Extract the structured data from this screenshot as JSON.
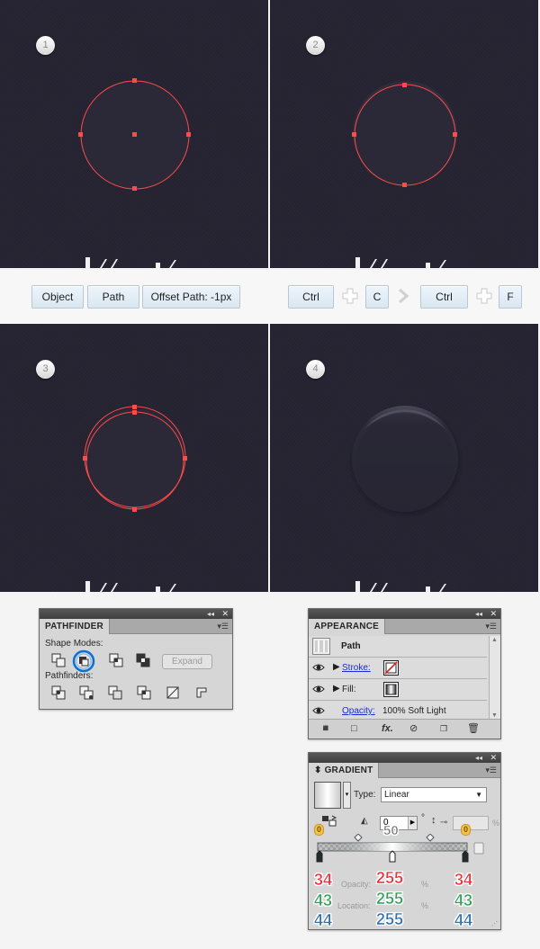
{
  "steps": [
    {
      "number": "1"
    },
    {
      "number": "2"
    },
    {
      "number": "3"
    },
    {
      "number": "4"
    }
  ],
  "colors": {
    "artboard": "#262432",
    "selection": "#ff4a4a",
    "circle_fill": "#2b2938",
    "highlight_ring": "#0a72d6"
  },
  "key_strip": {
    "left_keys": [
      "Object",
      "Path",
      "Offset Path: -1px"
    ],
    "right_keys": [
      "Ctrl",
      "C",
      "Ctrl",
      "F"
    ]
  },
  "pathfinder": {
    "title": "PATHFINDER",
    "shape_modes_label": "Shape Modes:",
    "pathfinders_label": "Pathfinders:",
    "expand_label": "Expand",
    "shape_mode_icons": [
      "unite-icon",
      "minus-front-icon",
      "intersect-icon",
      "exclude-icon"
    ],
    "pathfinder_icons": [
      "divide-icon",
      "trim-icon",
      "merge-icon",
      "crop-icon",
      "outline-icon",
      "minus-back-icon"
    ],
    "highlighted": "minus-front-icon"
  },
  "appearance": {
    "title": "APPEARANCE",
    "object_label": "Path",
    "stroke_label": "Stroke:",
    "fill_label": "Fill:",
    "opacity_label": "Opacity:",
    "opacity_value": "100% Soft Light"
  },
  "gradient": {
    "title": "GRADIENT",
    "type_label": "Type:",
    "type_value": "Linear",
    "angle_value": "0",
    "angle_unit": "°",
    "midpoint_value": "50",
    "badge_left": "0",
    "badge_right": "0",
    "percent": "%",
    "opacity_label": "Opacity:",
    "location_label": "Location:",
    "stops": [
      {
        "r": "34",
        "g": "43",
        "b": "44"
      },
      {
        "r": "255",
        "g": "255",
        "b": "255"
      },
      {
        "r": "34",
        "g": "43",
        "b": "44"
      }
    ]
  }
}
